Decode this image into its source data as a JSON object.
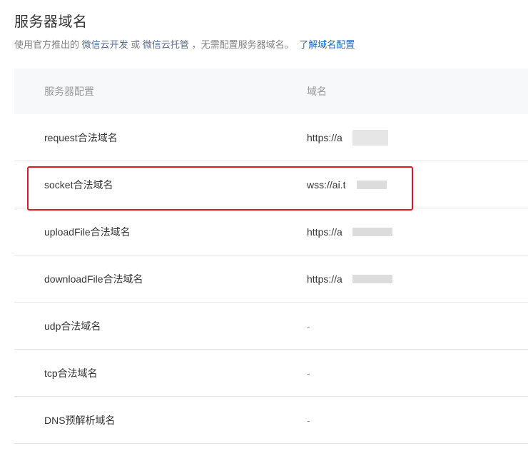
{
  "header": {
    "title": "服务器域名",
    "desc_prefix": "使用官方推出的",
    "link_dev": "微信云开发",
    "desc_or": "或",
    "link_hosting": "微信云托管",
    "desc_suffix": "，无需配置服务器域名。",
    "learn_link": "了解域名配置"
  },
  "table": {
    "headers": {
      "config": "服务器配置",
      "domain": "域名"
    },
    "rows": [
      {
        "label": "request合法域名",
        "value": "https://a"
      },
      {
        "label": "socket合法域名",
        "value": "wss://ai.t"
      },
      {
        "label": "uploadFile合法域名",
        "value": "https://a"
      },
      {
        "label": "downloadFile合法域名",
        "value": "https://a"
      },
      {
        "label": "udp合法域名",
        "value": "-"
      },
      {
        "label": "tcp合法域名",
        "value": "-"
      },
      {
        "label": "DNS预解析域名",
        "value": "-"
      }
    ]
  },
  "colors": {
    "link": "#576b95",
    "learn_link": "#1565c0",
    "highlight": "#e0181e"
  }
}
